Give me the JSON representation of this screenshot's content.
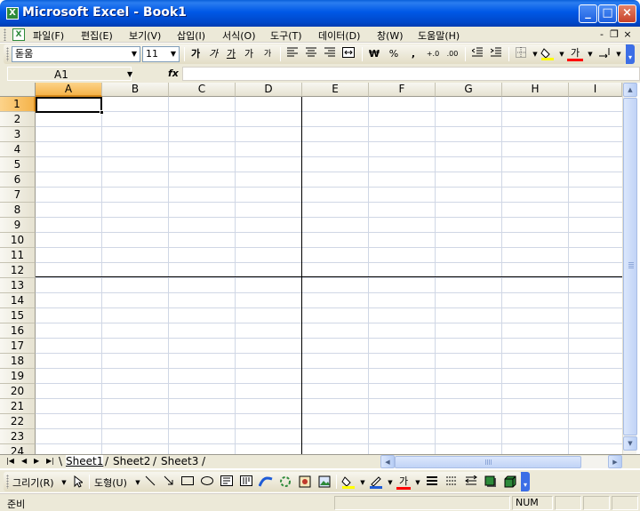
{
  "window": {
    "app_icon": "excel-icon",
    "title": "Microsoft Excel - Book1",
    "min_label": "_",
    "max_label": "□",
    "close_label": "×"
  },
  "menu": {
    "items": [
      {
        "label": "파일(F)"
      },
      {
        "label": "편집(E)"
      },
      {
        "label": "보기(V)"
      },
      {
        "label": "삽입(I)"
      },
      {
        "label": "서식(O)"
      },
      {
        "label": "도구(T)"
      },
      {
        "label": "데이터(D)"
      },
      {
        "label": "창(W)"
      },
      {
        "label": "도움말(H)"
      }
    ],
    "doc_minimize": "-",
    "doc_restore": "❐",
    "doc_close": "×"
  },
  "toolbar": {
    "font_name": "돋움",
    "font_size": "11",
    "bold": "가",
    "italic": "가",
    "underline": "가",
    "font_grow": "가",
    "font_shrink": "가",
    "currency": "₩",
    "percent": "%",
    "comma": ",",
    "increase_decimal": "+.0",
    "decrease_decimal": ".00",
    "font_color_label": "가",
    "accent_color": "#ff0000",
    "fill_color": "#ffff00"
  },
  "formula": {
    "name_box": "A1",
    "fx": "fx",
    "value": ""
  },
  "grid": {
    "columns": [
      "A",
      "B",
      "C",
      "D",
      "E",
      "F",
      "G",
      "H",
      "I"
    ],
    "rows": [
      "1",
      "2",
      "3",
      "4",
      "5",
      "6",
      "7",
      "8",
      "9",
      "10",
      "11",
      "12",
      "13",
      "14",
      "15",
      "16",
      "17",
      "18",
      "19",
      "20",
      "21",
      "22",
      "23",
      "24"
    ],
    "active_cell": "A1"
  },
  "sheets": {
    "tabs": [
      {
        "label": "Sheet1"
      },
      {
        "label": "Sheet2"
      },
      {
        "label": "Sheet3"
      }
    ],
    "active_index": 0
  },
  "drawing": {
    "draw_menu": "그리기(R)",
    "autoshapes_menu": "도형(U)",
    "font_color_label": "가"
  },
  "status": {
    "text": "준비",
    "num": "NUM"
  }
}
